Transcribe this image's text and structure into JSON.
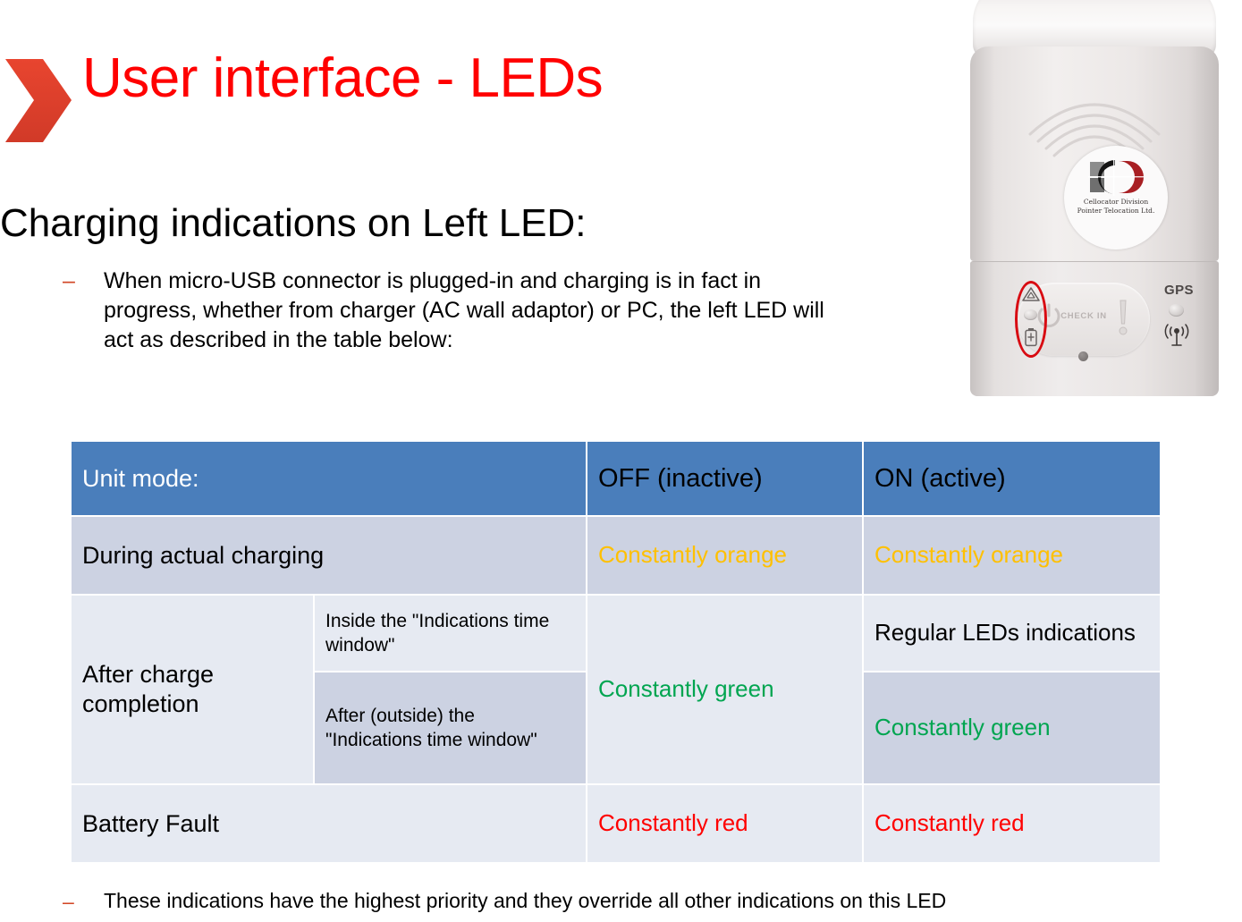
{
  "slide": {
    "title": "User interface - LEDs",
    "title_color": "#ff0000",
    "chevron_color": "#e03c2a",
    "lead_heading": "Charging indications on Left LED:",
    "bullet_dash": "–",
    "lead_bullet": "When micro-USB connector is plugged-in and charging is in fact in progress, whether from charger (AC wall adaptor) or PC, the left LED will act as described in the table below:",
    "footnote": "These indications have the highest priority and they override all other indications on this LED"
  },
  "table": {
    "header": {
      "unit_mode_label": "Unit mode:",
      "mode_off": "OFF (inactive)",
      "mode_on": "ON (active)",
      "header_bg": "#4a7ebb",
      "header_label_color": "#ffffff",
      "header_mode_color": "#000000"
    },
    "colors": {
      "band_light": "#e6eaf2",
      "band_dark": "#ccd2e2",
      "orange": "#ffc000",
      "green": "#00a550",
      "red": "#ff0000",
      "grid": "#ffffff"
    },
    "rows": [
      {
        "label": "During actual charging",
        "sublabel": "",
        "off": "Constantly orange",
        "on": "Constantly orange",
        "off_color": "orange",
        "on_color": "orange"
      },
      {
        "label": "After charge completion",
        "sublabel": "Inside the \"Indications time window\"",
        "off": "Constantly green",
        "on": "Regular LEDs indications",
        "off_color": "green",
        "on_color": "plain"
      },
      {
        "label": "",
        "sublabel": "After (outside) the \"Indications time window\"",
        "off": "",
        "on": "Constantly green",
        "off_color": "green",
        "on_color": "green"
      },
      {
        "label": "Battery Fault",
        "sublabel": "",
        "off": "Constantly red",
        "on": "Constantly red",
        "off_color": "red",
        "on_color": "red"
      }
    ]
  },
  "device": {
    "logo_line1": "Cellocator Division",
    "logo_line2": "Pointer Telocation Ltd.",
    "checkin_label": "CHECK IN",
    "gps_label": "GPS",
    "highlight_color": "#d80b12"
  }
}
